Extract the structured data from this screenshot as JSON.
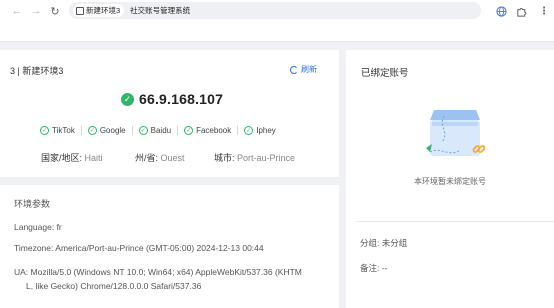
{
  "browser": {
    "tab_title": "新建环境3",
    "url_text": "社交账号管理系统",
    "accent_color": "#2f6fe0"
  },
  "env_card": {
    "title": "3 | 新建环境3",
    "refresh_label": "刷新",
    "ip": "66.9.168.107",
    "sites": [
      "TikTok",
      "Google",
      "Baidu",
      "Facebook",
      "Iphey"
    ],
    "country_label": "国家/地区:",
    "country_value": "Haiti",
    "state_label": "州/省:",
    "state_value": "Ouest",
    "city_label": "城市:",
    "city_value": "Port-au-Prince",
    "status_color": "#35b36b"
  },
  "params": {
    "heading": "环境参数",
    "language_label": "Language:",
    "language_value": "fr",
    "timezone_label": "Timezone:",
    "timezone_value": "America/Port-au-Prince (GMT-05:00) 2024-12-13 00:44",
    "ua_label": "UA:",
    "ua_value_line1": "Mozilla/5.0 (Windows NT 10.0; Win64; x64) AppleWebKit/537.36 (KHTM",
    "ua_value_line2": "L, like Gecko) Chrome/128.0.0.0 Safari/537.36"
  },
  "bound_accounts": {
    "title": "已绑定账号",
    "empty_text": "本环境暂未绑定账号",
    "group_label": "分组:",
    "group_value": "未分组",
    "note_label": "备注:",
    "note_value": "--"
  },
  "icons": [
    "back-arrow-icon",
    "forward-arrow-icon",
    "reload-icon",
    "tab-page-icon",
    "globe-icon",
    "extension-icon",
    "more-menu-icon",
    "refresh-icon",
    "check-circle-icon",
    "link-icon"
  ]
}
